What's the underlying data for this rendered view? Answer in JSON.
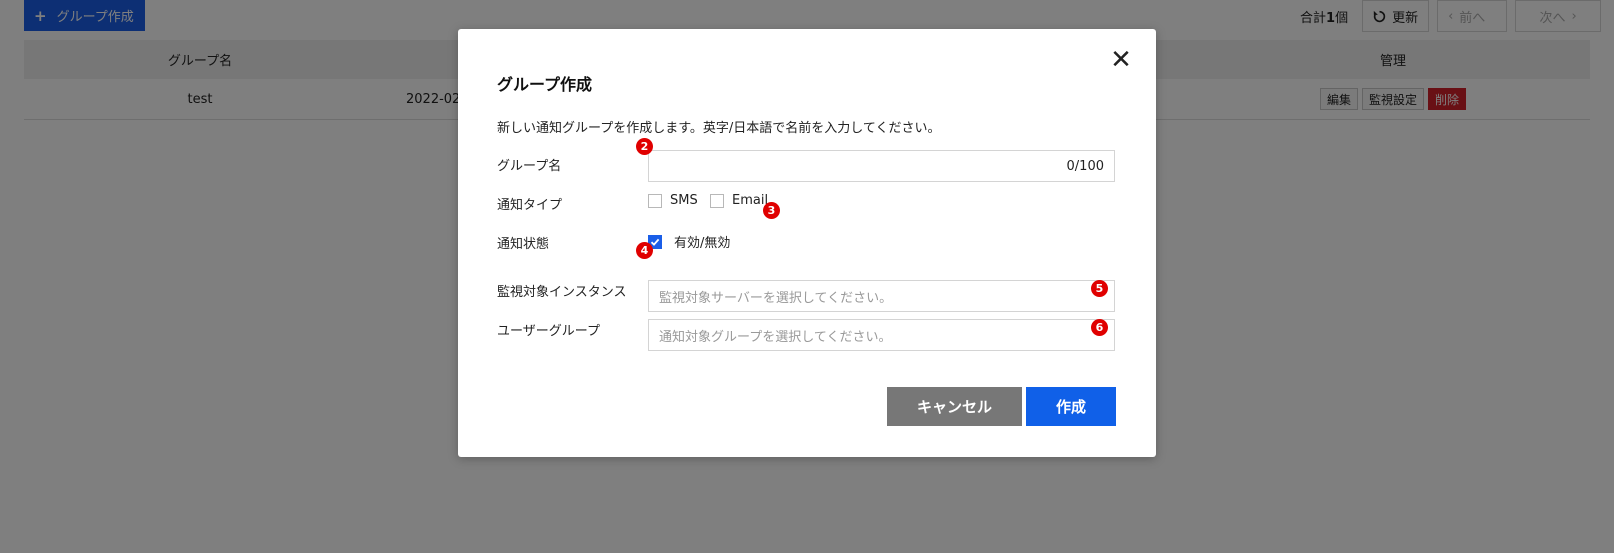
{
  "toolbar": {
    "create_group_label": "グループ作成",
    "total_prefix": "合計",
    "total_count": "1",
    "total_suffix": "個",
    "refresh_label": "更新",
    "prev_label": "前へ",
    "next_label": "次へ"
  },
  "table": {
    "headers": {
      "group_name": "グループ名",
      "manage": "管理"
    },
    "rows": [
      {
        "group_name": "test",
        "created": "2022-02-"
      }
    ],
    "actions": {
      "edit": "編集",
      "monitor_settings": "監視設定",
      "delete": "削除"
    }
  },
  "modal": {
    "title": "グループ作成",
    "description": "新しい通知グループを作成します。英字/日本語で名前を入力してください。",
    "fields": {
      "group_name_label": "グループ名",
      "group_name_value": "",
      "group_name_counter": "0/100",
      "notify_type_label": "通知タイプ",
      "sms_label": "SMS",
      "email_label": "Email",
      "notify_state_label": "通知状態",
      "state_option_label": "有効/無効",
      "instance_label": "監視対象インスタンス",
      "instance_placeholder": "監視対象サーバーを選択してください。",
      "user_group_label": "ユーザーグループ",
      "user_group_placeholder": "通知対象グループを選択してください。"
    },
    "buttons": {
      "cancel": "キャンセル",
      "create": "作成"
    },
    "markers": [
      "2",
      "3",
      "4",
      "5",
      "6"
    ]
  },
  "colors": {
    "primary": "#1a5ee8",
    "danger": "#d3202a",
    "marker": "#e00000",
    "cancel": "#777777"
  }
}
